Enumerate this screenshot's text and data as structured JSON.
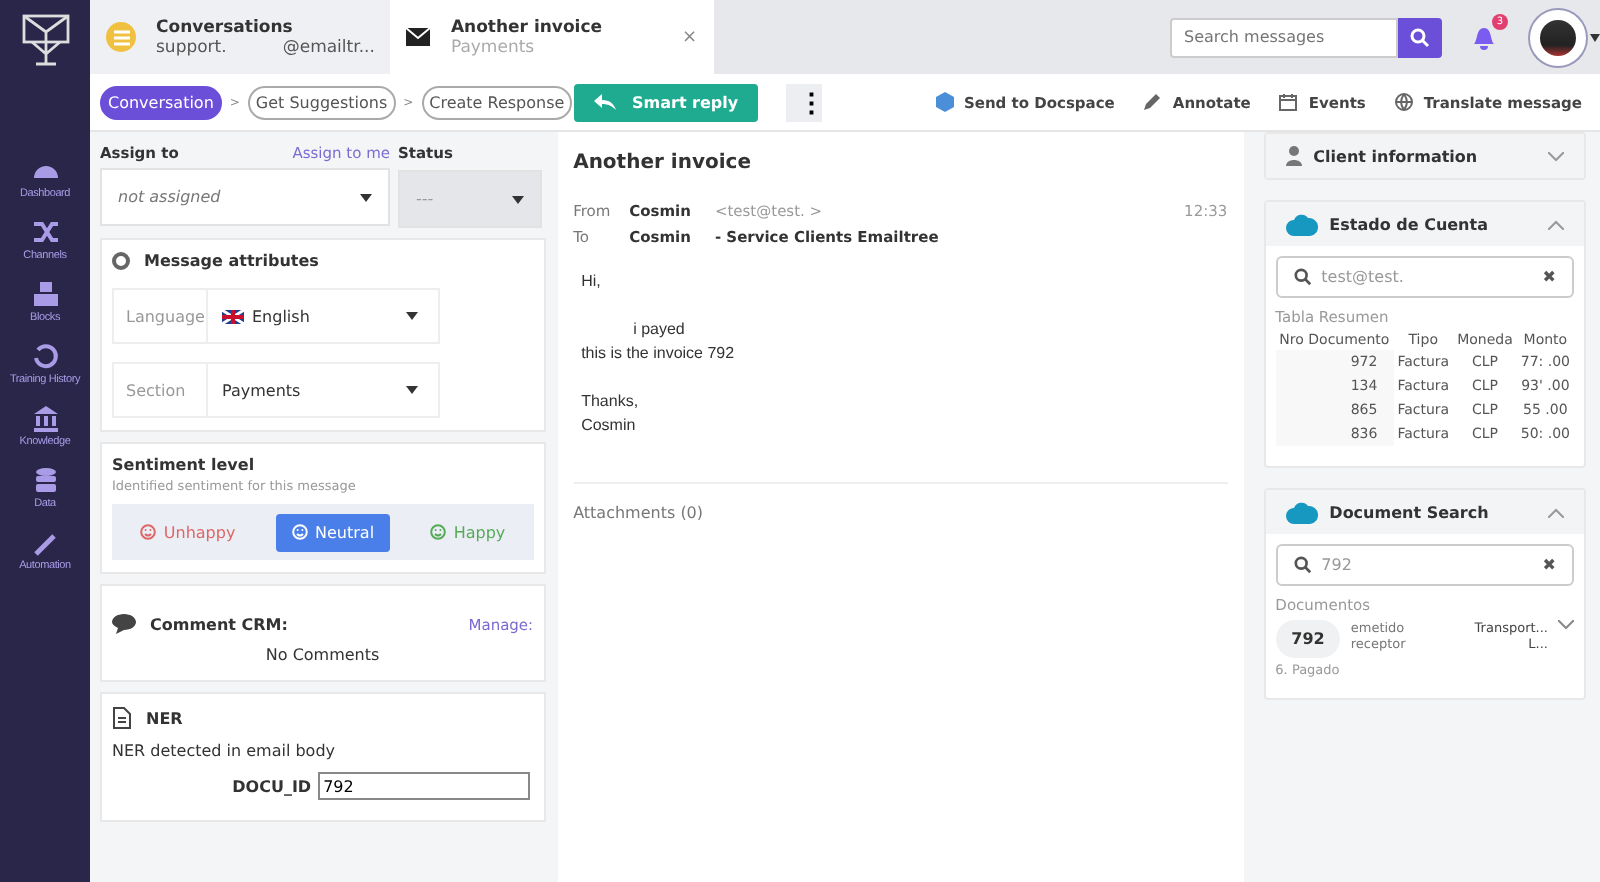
{
  "nav": [
    {
      "label": "Dashboard"
    },
    {
      "label": "Channels"
    },
    {
      "label": "Blocks"
    },
    {
      "label": "Training History"
    },
    {
      "label": "Knowledge"
    },
    {
      "label": "Data"
    },
    {
      "label": "Automation"
    }
  ],
  "tabs": [
    {
      "title": "Conversations",
      "subtitle": "support.",
      "subtitle_2": "@emailtr...",
      "selected": false
    },
    {
      "title": "Another invoice",
      "subtitle": "Payments",
      "close": "×",
      "selected": true
    }
  ],
  "search": {
    "placeholder": "Search messages"
  },
  "notifications": {
    "count": "3"
  },
  "steps": [
    {
      "label": "Conversation",
      "selected": true
    },
    {
      "label": "Get Suggestions",
      "selected": false
    },
    {
      "label": "Create Response",
      "selected": false
    }
  ],
  "step_separator": ">",
  "smart_reply": "Smart reply",
  "more": "⋮",
  "actions": [
    "Send to Docspace",
    "Annotate",
    "Events",
    "Translate message"
  ],
  "assign": {
    "label": "Assign to",
    "link": "Assign to me",
    "placeholder": "not assigned"
  },
  "status": {
    "label": "Status",
    "placeholder": "---"
  },
  "attributes": {
    "title": "Message attributes",
    "fields": [
      {
        "label": "Language",
        "value": "English"
      },
      {
        "label": "Section",
        "value": "Payments"
      }
    ]
  },
  "sentiment": {
    "title": "Sentiment level",
    "subtitle": "Identified sentiment for this message",
    "options": [
      {
        "label": "Unhappy",
        "selected": false
      },
      {
        "label": "Neutral",
        "selected": true
      },
      {
        "label": "Happy",
        "selected": false
      }
    ]
  },
  "comments": {
    "title": "Comment CRM:",
    "link": "Manage:",
    "empty": "No Comments"
  },
  "ner": {
    "title": "NER",
    "subtitle": "NER detected in email body",
    "field": "DOCU_ID",
    "value": "792"
  },
  "message": {
    "title": "Another invoice",
    "from_label": "From",
    "from_name": "Cosmin",
    "from_address": "<test@test.  >",
    "time": "12:33",
    "to_label": "To",
    "to_name": "Cosmin",
    "to_rest": "- Service Clients Emailtree",
    "body": [
      [
        "Hi,"
      ],
      [
        "i payed",
        "this is the invoice 792"
      ],
      [
        "Thanks,",
        "Cosmin"
      ]
    ],
    "attachments": "Attachments (0)"
  },
  "client_info": {
    "title": "Client information",
    "expanded": false
  },
  "account": {
    "title": "Estado de Cuenta",
    "expanded": true,
    "search": "test@test.",
    "clear": "✖",
    "table_title": "Tabla Resumen",
    "columns": [
      "Nro Documento",
      "Tipo",
      "Moneda",
      "Monto"
    ],
    "rows": [
      [
        "972",
        "Factura",
        "CLP",
        "77: .00"
      ],
      [
        "134",
        "Factura",
        "CLP",
        "93' .00"
      ],
      [
        "865",
        "Factura",
        "CLP",
        "55 .00"
      ],
      [
        "836",
        "Factura",
        "CLP",
        "50: .00"
      ]
    ]
  },
  "doc_search": {
    "title": "Document Search",
    "expanded": true,
    "search": "792",
    "clear": "✖",
    "list_title": "Documentos",
    "doc": {
      "number": "792",
      "issued_label": "emetido",
      "issued": "Transport...",
      "receiver_label": "receptor",
      "receiver": "L...",
      "status": "6. Pagado"
    }
  }
}
